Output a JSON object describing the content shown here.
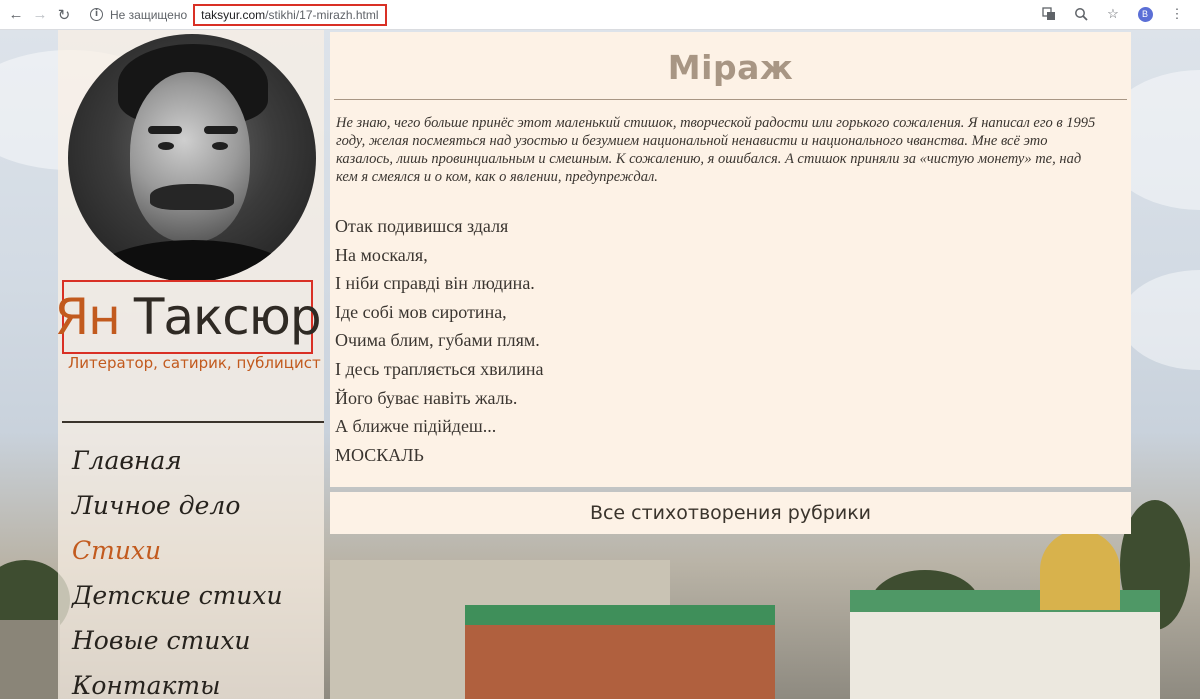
{
  "browser": {
    "security_label": "Не защищено",
    "url_domain": "taksyur.com",
    "url_path": "/stikhi/17-mirazh.html",
    "profile_initial": "B"
  },
  "site": {
    "author_first": "Ян",
    "author_last": "Таксюр",
    "tagline": "Литератор, сатирик, публицист"
  },
  "menu": [
    {
      "label": "Главная",
      "active": false
    },
    {
      "label": "Личное дело",
      "active": false
    },
    {
      "label": "Стихи",
      "active": true
    },
    {
      "label": "Детские стихи",
      "active": false
    },
    {
      "label": "Новые стихи",
      "active": false
    },
    {
      "label": "Контакты",
      "active": false
    }
  ],
  "article": {
    "title": "Міраж",
    "intro": "Не знаю, чего больше принёс этот маленький стишок, творческой радости или горького сожаления. Я написал его в 1995 году, желая посмеяться над узостью и безумием национальной ненависти и национального чванства. Мне всё это казалось, лишь провинциальным и смешным. К сожалению, я ошибался. А стишок приняли за «чистую монету» те, над кем я смеялся и о ком, как о явлении, предупреждал.",
    "poem_lines": [
      "Отак подивишся здаля",
      "На москаля,",
      "І ніби справді він людина.",
      "Іде собі мов сиротина,",
      "Очима блим, губами плям.",
      "І десь трапляється хвилина",
      "Його буває навіть жаль.",
      "А ближче підійдеш...",
      "МОСКАЛЬ"
    ]
  },
  "rubric_link": "Все стихотворения рубрики",
  "colors": {
    "accent": "#c25a1e",
    "title": "#a89684",
    "content_bg": "#fdf2e6",
    "highlight_border": "#d93025"
  }
}
